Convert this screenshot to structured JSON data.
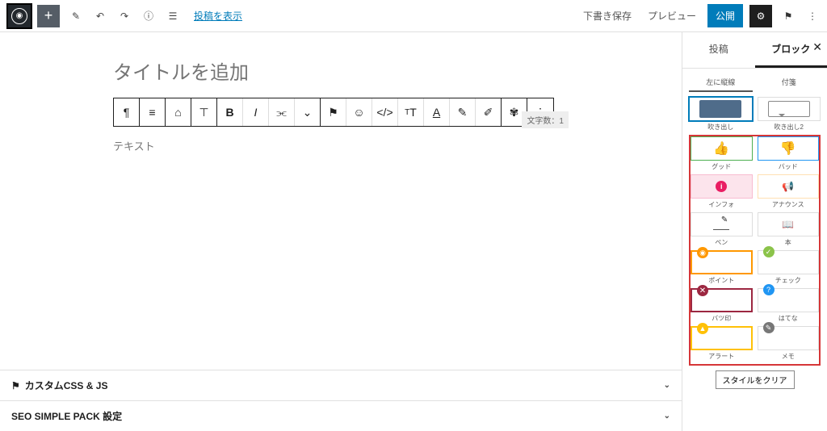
{
  "topbar": {
    "view_post": "投稿を表示",
    "save_draft": "下書き保存",
    "preview": "プレビュー",
    "publish": "公開"
  },
  "editor": {
    "title_placeholder": "タイトルを追加",
    "word_count": "文字数：1",
    "paragraph_placeholder": "テキスト"
  },
  "panels": {
    "css_js": "カスタムCSS & JS",
    "seo": "SEO SIMPLE PACK 設定"
  },
  "sidebar": {
    "tab_post": "投稿",
    "tab_block": "ブロック",
    "subtab_left": "左に縦線",
    "subtab_right": "付箋",
    "clear_style": "スタイルをクリア",
    "styles": {
      "balloon1": "吹き出し",
      "balloon2": "吹き出し2",
      "good": "グッド",
      "bad": "バッド",
      "info": "インフォ",
      "announce": "アナウンス",
      "pen": "ペン",
      "book": "本",
      "point": "ポイント",
      "check": "チェック",
      "batsu": "バツ印",
      "hatena": "はてな",
      "alert": "アラート",
      "memo": "メモ"
    }
  }
}
